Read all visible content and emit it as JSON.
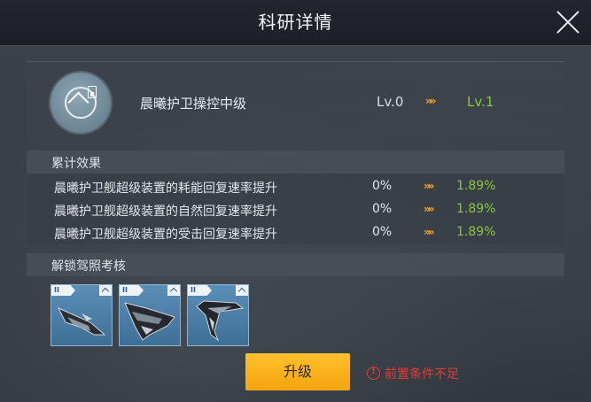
{
  "header": {
    "title": "科研详情"
  },
  "research": {
    "name": "晨曦护卫操控中级",
    "level_from": "Lv.0",
    "level_to": "Lv.1",
    "arrows": "»»"
  },
  "effects": {
    "title": "累计效果",
    "rows": [
      {
        "label": "晨曦护卫舰超级装置的耗能回复速率提升",
        "from": "0%",
        "to": "1.89%"
      },
      {
        "label": "晨曦护卫舰超级装置的自然回复速率提升",
        "from": "0%",
        "to": "1.89%"
      },
      {
        "label": "晨曦护卫舰超级装置的受击回复速率提升",
        "from": "0%",
        "to": "1.89%"
      }
    ]
  },
  "unlock": {
    "title": "解锁驾照考核",
    "ships": [
      {
        "tier": "II",
        "icon": "frigate-ship-icon"
      },
      {
        "tier": "II",
        "icon": "cruiser-ship-icon"
      },
      {
        "tier": "II",
        "icon": "interceptor-ship-icon"
      }
    ]
  },
  "actions": {
    "upgrade_label": "升级",
    "warning": "前置条件不足"
  },
  "colors": {
    "accent": "#f4a40d",
    "positive": "#8cc63f",
    "warning": "#e53b34"
  }
}
